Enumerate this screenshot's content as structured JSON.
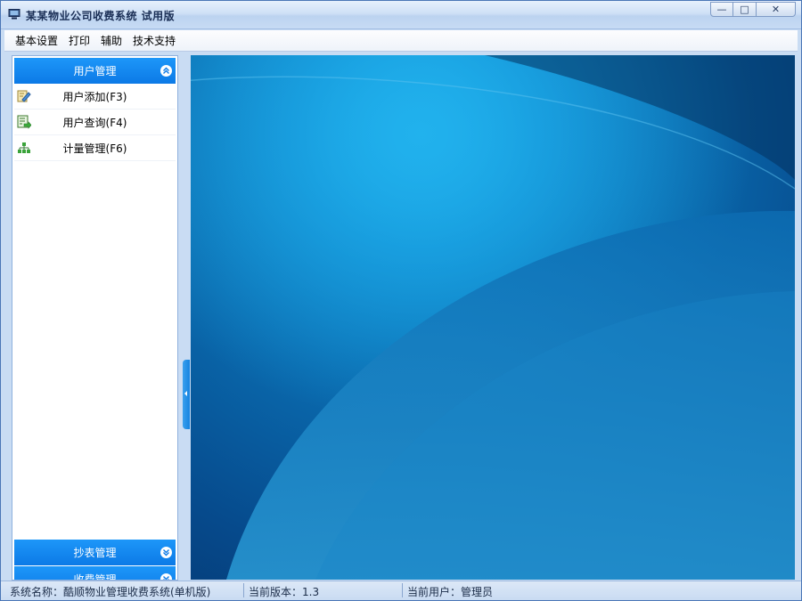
{
  "window": {
    "title": "某某物业公司收费系统 试用版",
    "icon": "computer-icon",
    "controls": {
      "minimize": "—",
      "maximize": "□",
      "close": "✕"
    }
  },
  "menu": {
    "items": [
      "基本设置",
      "打印",
      "辅助",
      "技术支持"
    ]
  },
  "sidebar": {
    "groups": [
      {
        "title": "用户管理",
        "expanded": true,
        "items": [
          {
            "label": "用户添加(F3)",
            "icon": "pencil-edit-icon"
          },
          {
            "label": "用户查询(F4)",
            "icon": "search-document-icon"
          },
          {
            "label": "计量管理(F6)",
            "icon": "org-tree-icon"
          }
        ]
      },
      {
        "title": "抄表管理",
        "expanded": false
      },
      {
        "title": "收费管理",
        "expanded": false
      }
    ]
  },
  "status": {
    "system_name": "系统名称：酷顺物业管理收费系统(单机版)",
    "version": "当前版本：1.3",
    "current_user": "当前用户：管理员"
  },
  "colors": {
    "accent": "#0c7ae6",
    "main_bg": "#0a6aae"
  }
}
